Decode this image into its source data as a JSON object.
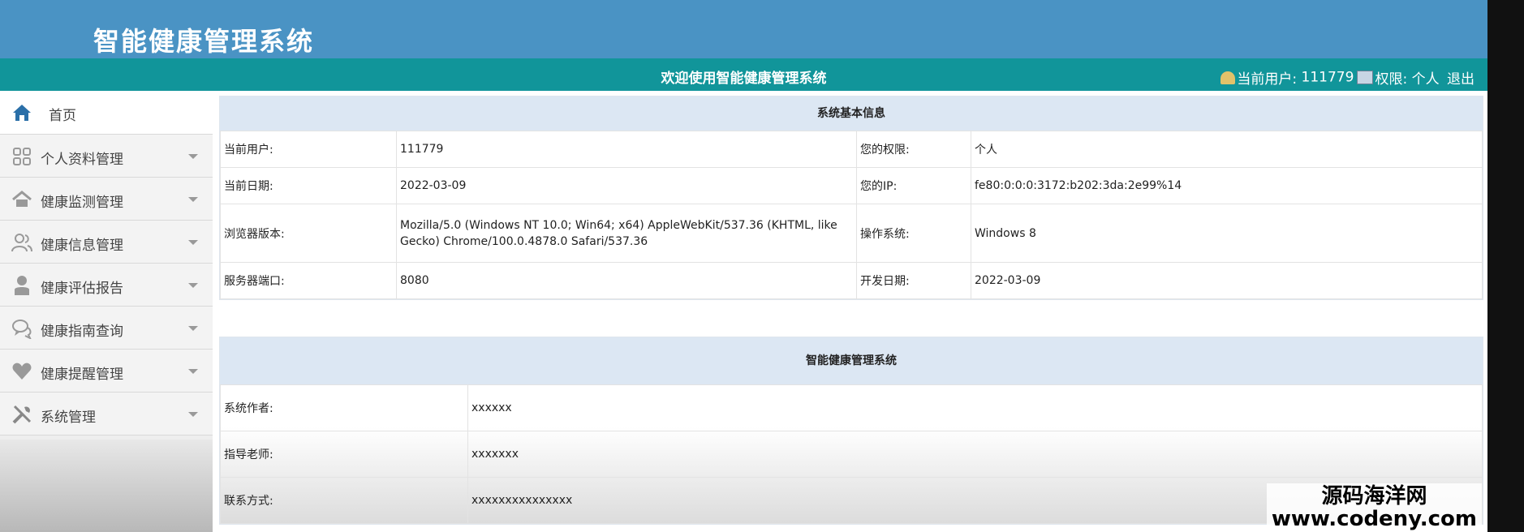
{
  "header": {
    "title": "智能健康管理系统"
  },
  "topbar": {
    "welcome": "欢迎使用智能健康管理系统",
    "user_label": "当前用户:",
    "user_value": "111779",
    "role_label": "权限:",
    "role_value": "个人",
    "logout_label": "退出"
  },
  "sidebar": {
    "items": [
      {
        "label": "首页",
        "icon": "home-icon"
      },
      {
        "label": "个人资料管理",
        "icon": "grid-icon"
      },
      {
        "label": "健康监测管理",
        "icon": "home-outline-icon"
      },
      {
        "label": "健康信息管理",
        "icon": "users-icon"
      },
      {
        "label": "健康评估报告",
        "icon": "user-icon"
      },
      {
        "label": "健康指南查询",
        "icon": "chat-icon"
      },
      {
        "label": "健康提醒管理",
        "icon": "heart-icon"
      },
      {
        "label": "系统管理",
        "icon": "tools-icon"
      }
    ]
  },
  "sysinfo": {
    "title": "系统基本信息",
    "rows": [
      {
        "l1": "当前用户:",
        "v1": "111779",
        "l2": "您的权限:",
        "v2": "个人"
      },
      {
        "l1": "当前日期:",
        "v1": "2022-03-09",
        "l2": "您的IP:",
        "v2": "fe80:0:0:0:3172:b202:3da:2e99%14"
      },
      {
        "l1": "浏览器版本:",
        "v1": "Mozilla/5.0 (Windows NT 10.0; Win64; x64) AppleWebKit/537.36 (KHTML, like Gecko) Chrome/100.0.4878.0 Safari/537.36",
        "l2": "操作系统:",
        "v2": "Windows 8"
      },
      {
        "l1": "服务器端口:",
        "v1": "8080",
        "l2": "开发日期:",
        "v2": "2022-03-09"
      }
    ]
  },
  "about": {
    "title": "智能健康管理系统",
    "rows": [
      {
        "label": "系统作者:",
        "value": "xxxxxx"
      },
      {
        "label": "指导老师:",
        "value": "xxxxxxx"
      },
      {
        "label": "联系方式:",
        "value": "xxxxxxxxxxxxxxx"
      }
    ]
  },
  "watermark": {
    "line1": "源码海洋网",
    "line2": "www.codeny.com"
  },
  "colors": {
    "header": "#4a93c4",
    "topbar": "#11959a",
    "panel_head": "#dce7f3"
  }
}
